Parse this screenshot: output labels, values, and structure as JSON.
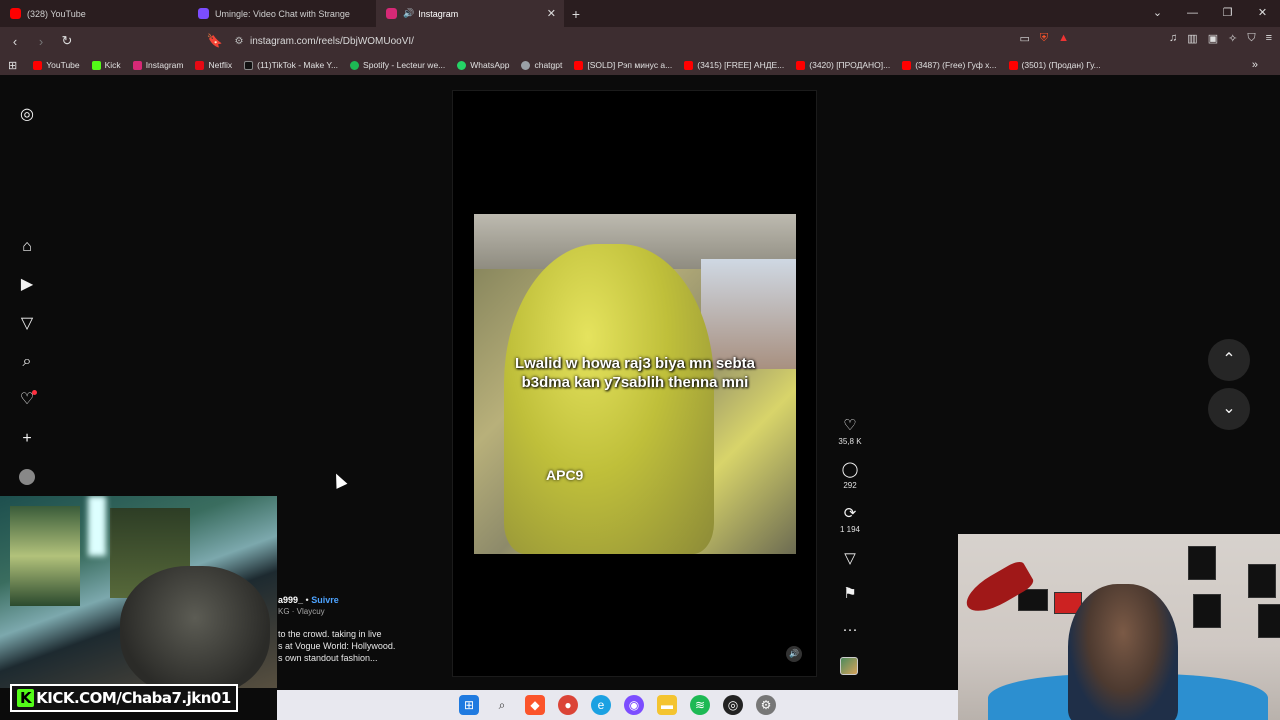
{
  "browser": {
    "tabs": [
      {
        "title": "(328) YouTube",
        "fav_color": "#ff0000",
        "active": false
      },
      {
        "title": "Umingle: Video Chat with Strange",
        "fav_color": "#7c4dff",
        "active": false
      },
      {
        "title": "Instagram",
        "fav_color": "#d62976",
        "active": true
      }
    ],
    "new_tab": "+",
    "url": "instagram.com/reels/DbjWOMUooVI/",
    "bookmarks": [
      {
        "label": "YouTube",
        "color": "#ff0000"
      },
      {
        "label": "Kick",
        "color": "#53fc18"
      },
      {
        "label": "Instagram",
        "color": "#d62976"
      },
      {
        "label": "Netflix",
        "color": "#e50914"
      },
      {
        "label": "(11)TikTok - Make Y...",
        "color": "#111111"
      },
      {
        "label": "Spotify - Lecteur we...",
        "color": "#1db954"
      },
      {
        "label": "WhatsApp",
        "color": "#25d366"
      },
      {
        "label": "chatgpt",
        "color": "#9aa0a6"
      },
      {
        "label": "[SOLD] Рэп минус а...",
        "color": "#ff0000"
      },
      {
        "label": "(3415) [FREE] АНДЕ...",
        "color": "#ff0000"
      },
      {
        "label": "(3420) [ПРОДАНО]...",
        "color": "#ff0000"
      },
      {
        "label": "(3487) (Free) Гуф x...",
        "color": "#ff0000"
      },
      {
        "label": "(3501) (Продан) Гу...",
        "color": "#ff0000"
      }
    ]
  },
  "reel": {
    "caption_line1": "Lwalid w howa raj3 biya mn sebta",
    "caption_line2": "b3dma kan y7sablih thenna mni",
    "overlay_text": "APC9",
    "likes": "35,8 K",
    "comments": "292",
    "reposts": "1 194"
  },
  "prev_post": {
    "username": "a999_",
    "separator": "•",
    "follow": "Suivre",
    "audio": "KG · Vlaycuy",
    "desc_line1": "to the crowd. taking in live",
    "desc_line2": "s at Vogue World: Hollywood.",
    "desc_line3": "s own standout fashion..."
  },
  "stream": {
    "kick_badge": "K",
    "kick_url": "KICK.COM/Chaba7.jkn01"
  }
}
